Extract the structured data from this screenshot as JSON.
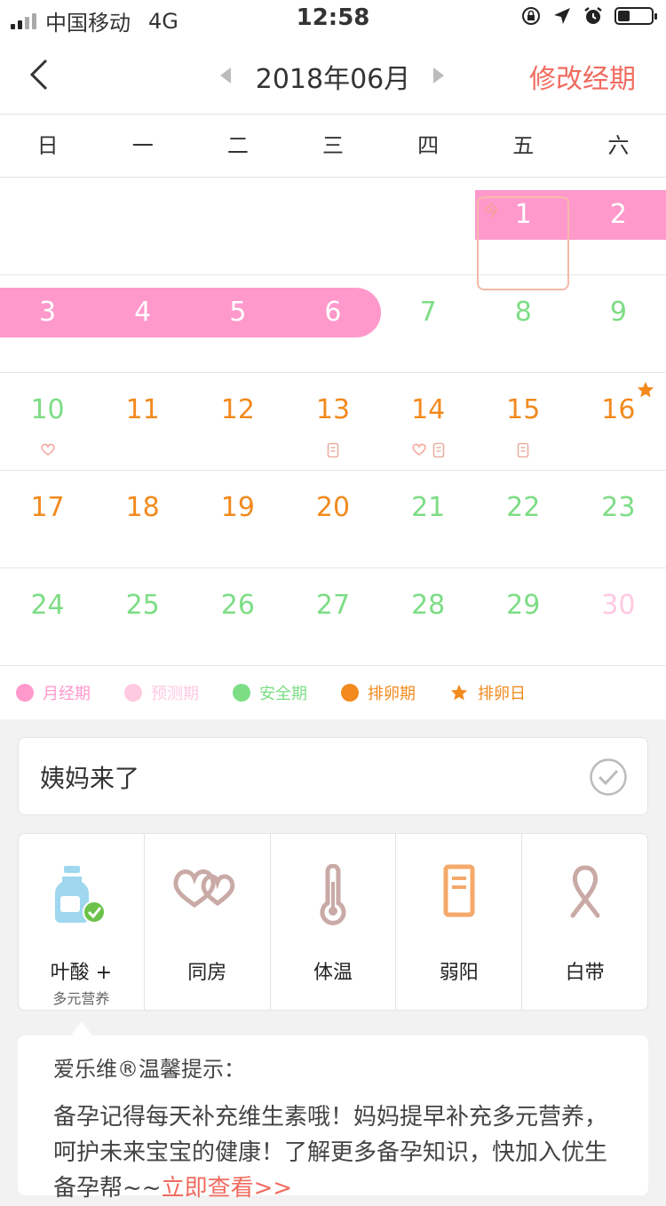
{
  "status": {
    "carrier": "中国移动",
    "network": "4G",
    "time": "12:58",
    "battery_level": 0.35
  },
  "nav": {
    "month": "2018年06月",
    "edit_label": "修改经期"
  },
  "weekdays": [
    "日",
    "一",
    "二",
    "三",
    "四",
    "五",
    "六"
  ],
  "today_label": "今",
  "days": {
    "d1": "1",
    "d2": "2",
    "d3": "3",
    "d4": "4",
    "d5": "5",
    "d6": "6",
    "d7": "7",
    "d8": "8",
    "d9": "9",
    "d10": "10",
    "d11": "11",
    "d12": "12",
    "d13": "13",
    "d14": "14",
    "d15": "15",
    "d16": "16",
    "d17": "17",
    "d18": "18",
    "d19": "19",
    "d20": "20",
    "d21": "21",
    "d22": "22",
    "d23": "23",
    "d24": "24",
    "d25": "25",
    "d26": "26",
    "d27": "27",
    "d28": "28",
    "d29": "29",
    "d30": "30"
  },
  "legend": [
    {
      "label": "月经期",
      "color": "#ff99cc"
    },
    {
      "label": "预测期",
      "color": "#ffc9e1"
    },
    {
      "label": "安全期",
      "color": "#7ddd85"
    },
    {
      "label": "排卵期",
      "color": "#f28a1e"
    },
    {
      "label": "排卵日",
      "color": "#f28a1e",
      "icon": "star-icon"
    }
  ],
  "period_card": {
    "label": "姨妈来了"
  },
  "tools": [
    {
      "label": "叶酸 +",
      "sub": "多元营养",
      "icon": "bottle-icon"
    },
    {
      "label": "同房",
      "icon": "double-heart-icon"
    },
    {
      "label": "体温",
      "icon": "thermometer-icon"
    },
    {
      "label": "弱阳",
      "icon": "test-strip-icon"
    },
    {
      "label": "白带",
      "icon": "ribbon-icon"
    }
  ],
  "tip": {
    "title": "爱乐维®温馨提示：",
    "body": "备孕记得每天补充维生素哦！妈妈提早补充多元营养，呵护未来宝宝的健康！了解更多备孕知识，快加入优生备孕帮~~",
    "link": "立即查看>>"
  },
  "colors": {
    "accent": "#f06b5f",
    "period": "#ff99cc",
    "safe": "#7ddd85",
    "ovulation": "#f28a1e",
    "predicted": "#ffc9e1"
  }
}
